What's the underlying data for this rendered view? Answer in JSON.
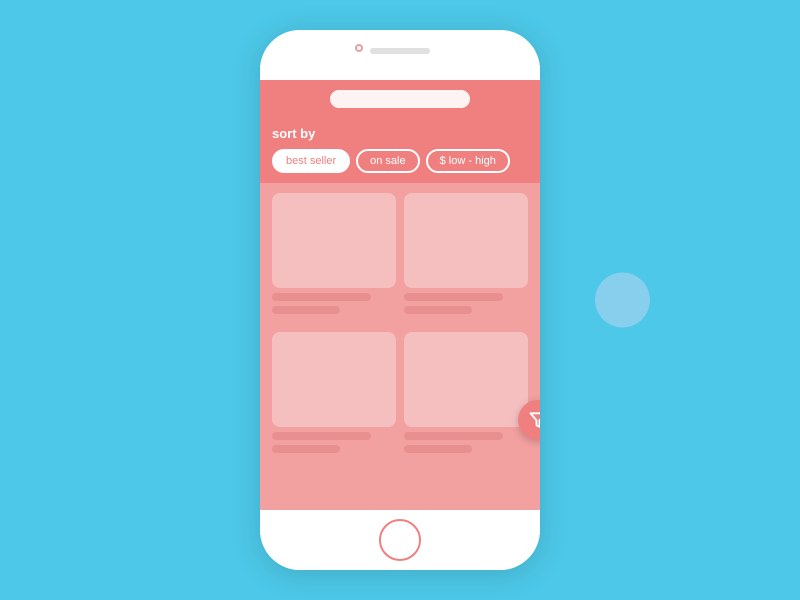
{
  "background_color": "#4dc8e8",
  "phone": {
    "search_bar_placeholder": "",
    "sort_section": {
      "label": "sort by",
      "buttons": [
        {
          "id": "best-seller",
          "label": "best seller",
          "active": true
        },
        {
          "id": "on-sale",
          "label": "on sale",
          "active": false
        },
        {
          "id": "price-low-high",
          "label": "$ low - high",
          "active": false
        }
      ]
    },
    "products": [
      {
        "id": 1
      },
      {
        "id": 2
      },
      {
        "id": 3
      },
      {
        "id": 4
      }
    ]
  },
  "fab": {
    "label": "filter"
  },
  "decoration": {
    "circle": "floating circle"
  }
}
